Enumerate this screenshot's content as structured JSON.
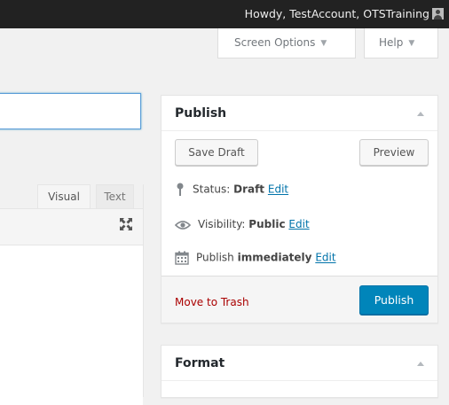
{
  "admin_bar": {
    "greeting": "Howdy, TestAccount, OTSTraining",
    "avatar_icon": "user-avatar-icon"
  },
  "screen_meta": {
    "screen_options": "Screen Options",
    "help": "Help"
  },
  "editor": {
    "tabs": [
      {
        "label": "Visual"
      },
      {
        "label": "Text"
      }
    ],
    "fullscreen_icon": "expand-icon"
  },
  "publish_box": {
    "title": "Publish",
    "save_draft": "Save Draft",
    "preview": "Preview",
    "status_label": "Status:",
    "status_value": "Draft",
    "status_edit": "Edit",
    "visibility_label": "Visibility:",
    "visibility_value": "Public",
    "visibility_edit": "Edit",
    "schedule_label": "Publish",
    "schedule_value": "immediately",
    "schedule_edit": "Edit",
    "move_to_trash": "Move to Trash",
    "publish_button": "Publish",
    "icons": {
      "status": "pin-icon",
      "visibility": "eye-icon",
      "schedule": "calendar-icon"
    }
  },
  "format_box": {
    "title": "Format"
  },
  "colors": {
    "admin_bar": "#222222",
    "link": "#0073aa",
    "primary_button": "#0085ba",
    "trash": "#aa0000"
  }
}
